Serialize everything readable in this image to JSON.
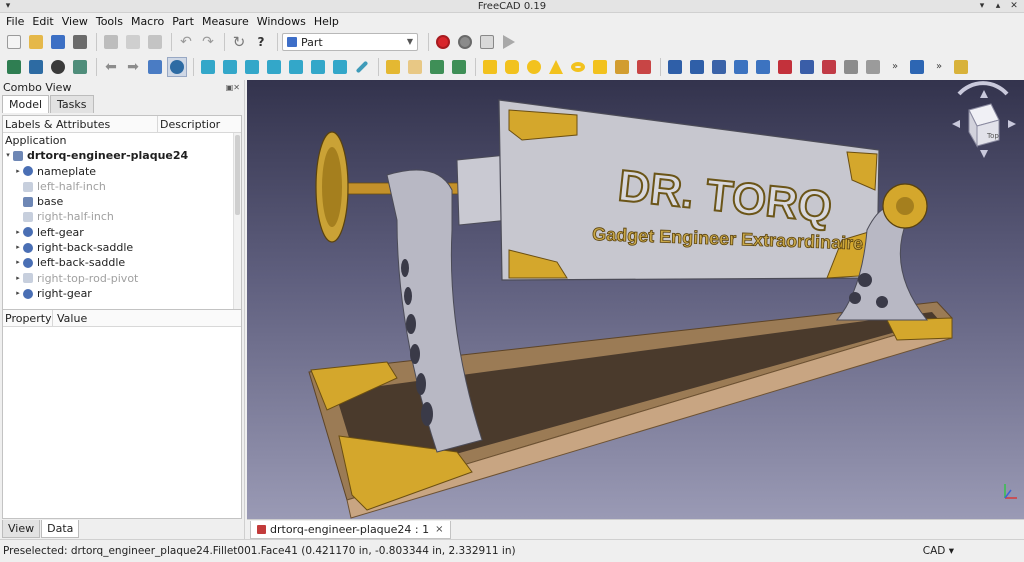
{
  "window": {
    "title": "FreeCAD 0.19"
  },
  "menu": [
    "File",
    "Edit",
    "View",
    "Tools",
    "Macro",
    "Part",
    "Measure",
    "Windows",
    "Help"
  ],
  "workbench": {
    "selected": "Part"
  },
  "colors": {
    "background_top": "#33334d",
    "background_bottom": "#9a9ab5",
    "record": "#d8262c",
    "brass": "#d4a72c",
    "steel": "#b8b8c4",
    "wood": "#9b7b55"
  },
  "combo": {
    "title": "Combo View",
    "tabs": [
      "Model",
      "Tasks"
    ],
    "tree_headers": [
      "Labels & Attributes",
      "Descriptior"
    ],
    "application_label": "Application",
    "document": "drtorq-engineer-plaque24",
    "items": [
      {
        "label": "nameplate",
        "faded": false,
        "expandable": true
      },
      {
        "label": "left-half-inch",
        "faded": true,
        "expandable": false
      },
      {
        "label": "base",
        "faded": false,
        "expandable": false
      },
      {
        "label": "right-half-inch",
        "faded": true,
        "expandable": false
      },
      {
        "label": "left-gear",
        "faded": false,
        "expandable": true
      },
      {
        "label": "right-back-saddle",
        "faded": false,
        "expandable": true
      },
      {
        "label": "left-back-saddle",
        "faded": false,
        "expandable": true
      },
      {
        "label": "right-top-rod-pivot",
        "faded": true,
        "expandable": true
      },
      {
        "label": "right-gear",
        "faded": false,
        "expandable": true
      }
    ],
    "property_headers": [
      "Property",
      "Value"
    ],
    "bottom_tabs": [
      "View",
      "Data"
    ]
  },
  "scene": {
    "plaque_line1": "DR. TORQ",
    "plaque_line2": "Gadget Engineer Extraordinaire",
    "navcube_face": "Top"
  },
  "doc_tab": {
    "label": "drtorq-engineer-plaque24 : 1"
  },
  "status": {
    "message": "Preselected: drtorq_engineer_plaque24.Fillet001.Face41 (0.421170 in, -0.803344 in, 2.332911 in)",
    "units": "CAD"
  }
}
